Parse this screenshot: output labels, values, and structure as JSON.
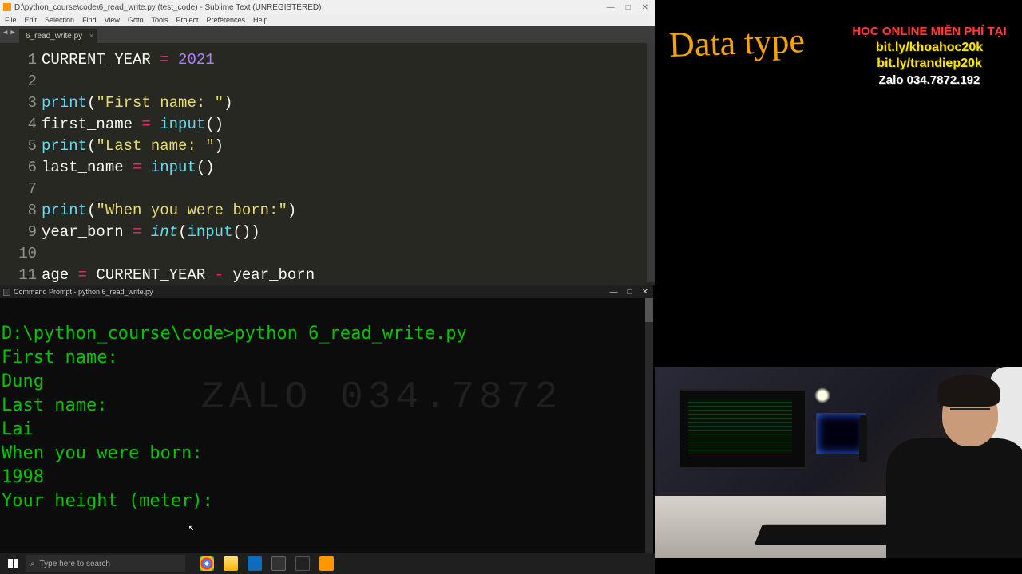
{
  "editor": {
    "window_title": "D:\\python_course\\code\\6_read_write.py (test_code) - Sublime Text (UNREGISTERED)",
    "menu": [
      "File",
      "Edit",
      "Selection",
      "Find",
      "View",
      "Goto",
      "Tools",
      "Project",
      "Preferences",
      "Help"
    ],
    "tab_label": "6_read_write.py",
    "tab_close": "×",
    "win_min": "—",
    "win_max": "□",
    "win_close": "✕",
    "lines": [
      "1",
      "2",
      "3",
      "4",
      "5",
      "6",
      "7",
      "8",
      "9",
      "10",
      "11"
    ],
    "code": {
      "l1_var": "CURRENT_YEAR",
      "l1_op": " = ",
      "l1_num": "2021",
      "l3_fn": "print",
      "l3_p1": "(",
      "l3_str": "\"First name: \"",
      "l3_p2": ")",
      "l4_var": "first_name",
      "l4_op": " = ",
      "l4_fn": "input",
      "l4_par": "()",
      "l5_fn": "print",
      "l5_p1": "(",
      "l5_str": "\"Last name: \"",
      "l5_p2": ")",
      "l6_var": "last_name",
      "l6_op": " = ",
      "l6_fn": "input",
      "l6_par": "()",
      "l8_fn": "print",
      "l8_p1": "(",
      "l8_str": "\"When you were born:\"",
      "l8_p2": ")",
      "l9_var": "year_born",
      "l9_op": " = ",
      "l9_int": "int",
      "l9_p1": "(",
      "l9_fn": "input",
      "l9_par": "()",
      "l9_p2": ")",
      "l11_var": "age",
      "l11_op1": " = ",
      "l11_a": "CURRENT_YEAR",
      "l11_op2": " - ",
      "l11_b": "year_born"
    }
  },
  "cmd": {
    "window_title": "Command Prompt - python  6_read_write.py",
    "win_min": "—",
    "win_max": "□",
    "win_close": "✕",
    "prompt": "D:\\python_course\\code>python 6_read_write.py",
    "out": [
      "First name:",
      "Dung",
      "Last name:",
      "Lai",
      "When you were born:",
      "1998",
      "Your height (meter):"
    ],
    "watermark": "ZALO 034.7872"
  },
  "board": {
    "title": "Data type"
  },
  "promo": {
    "l1": "HỌC ONLINE MIỄN PHÍ TẠI",
    "l2": "bit.ly/khoahoc20k",
    "l3": "bit.ly/trandiep20k",
    "l4": "Zalo 034.7872.192"
  },
  "taskbar": {
    "search_placeholder": "Type here to search"
  }
}
